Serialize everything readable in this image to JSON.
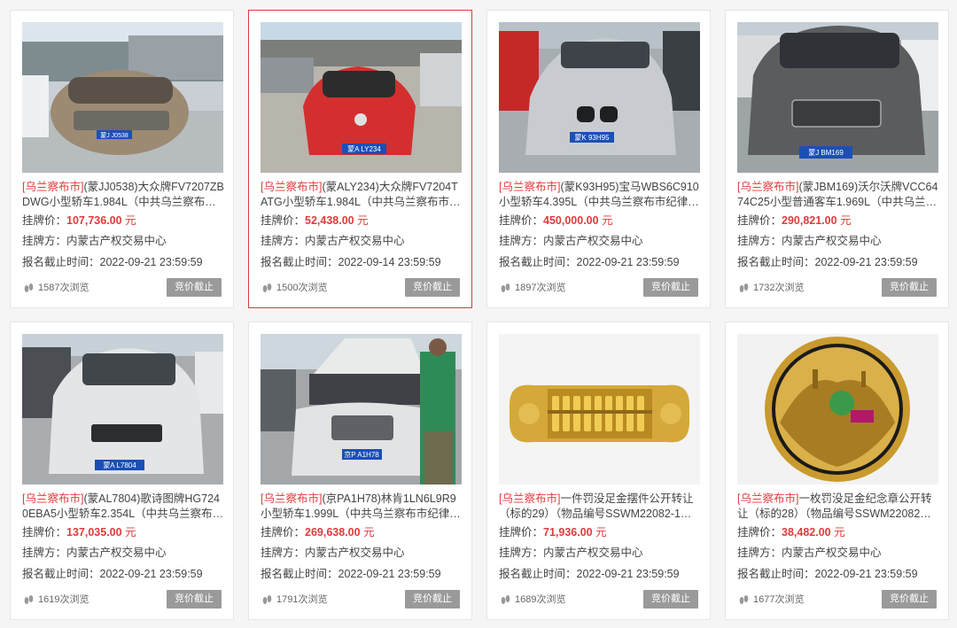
{
  "labels": {
    "price_label": "挂牌价：",
    "owner_label": "挂牌方：",
    "deadline_label": "报名截止时间：",
    "views_suffix": "次浏览",
    "currency_unit": "元"
  },
  "colors": {
    "accent": "#e03b3b",
    "button": "#9a9a9a"
  },
  "cards": [
    {
      "region": "[乌兰察布市]",
      "title": "(蒙JJ0538)大众牌FV7207ZBDWG小型轿车1.984L（中共乌兰察布…",
      "price": "107,736.00",
      "owner": "内蒙古产权交易中心",
      "deadline": "2022-09-21 23:59:59",
      "views": "1587",
      "status": "竞价截止",
      "plate": "蒙J J0538",
      "image": "silver-sedan-photo"
    },
    {
      "region": "[乌兰察布市]",
      "title": "(蒙ALY234)大众牌FV7204TATG小型轿车1.984L（中共乌兰察布市…",
      "price": "52,438.00",
      "owner": "内蒙古产权交易中心",
      "deadline": "2022-09-14 23:59:59",
      "views": "1500",
      "status": "竞价截止",
      "plate": "蒙A LY234",
      "image": "red-hatchback-photo"
    },
    {
      "region": "[乌兰察布市]",
      "title": "(蒙K93H95)宝马WBS6C910小型轿车4.395L（中共乌兰察布市纪律…",
      "price": "450,000.00",
      "owner": "内蒙古产权交易中心",
      "deadline": "2022-09-21 23:59:59",
      "views": "1897",
      "status": "竞价截止",
      "plate": "蒙K 93H95",
      "image": "silver-coupe-photo"
    },
    {
      "region": "[乌兰察布市]",
      "title": "(蒙JBM169)沃尔沃牌VCC6474C25小型普通客车1.969L（中共乌兰…",
      "price": "290,821.00",
      "owner": "内蒙古产权交易中心",
      "deadline": "2022-09-21 23:59:59",
      "views": "1732",
      "status": "竞价截止",
      "plate": "蒙J BM169",
      "image": "grey-suv-photo"
    },
    {
      "region": "[乌兰察布市]",
      "title": "(蒙AL7804)歌诗图牌HG7240EBA5小型轿车2.354L（中共乌兰察布…",
      "price": "137,035.00",
      "owner": "内蒙古产权交易中心",
      "deadline": "2022-09-21 23:59:59",
      "views": "1619",
      "status": "竞价截止",
      "plate": "蒙A L7804",
      "image": "white-crossover-photo"
    },
    {
      "region": "[乌兰察布市]",
      "title": "(京PA1H78)林肯1LN6L9R9小型轿车1.999L（中共乌兰察布市纪律…",
      "price": "269,638.00",
      "owner": "内蒙古产权交易中心",
      "deadline": "2022-09-21 23:59:59",
      "views": "1791",
      "status": "竞价截止",
      "plate": "京P A1H78",
      "image": "white-sedan-hood-open-photo"
    },
    {
      "region": "[乌兰察布市]",
      "title": "一件罚没足金摆件公开转让（标的29）（物品编号SSWM22082-1…",
      "price": "71,936.00",
      "owner": "内蒙古产权交易中心",
      "deadline": "2022-09-21 23:59:59",
      "views": "1689",
      "status": "竞价截止",
      "plate": "",
      "image": "gold-abacus-photo"
    },
    {
      "region": "[乌兰察布市]",
      "title": "一枚罚没足金纪念章公开转让（标的28）（物品编号SSWM22082…",
      "price": "38,482.00",
      "owner": "内蒙古产权交易中心",
      "deadline": "2022-09-21 23:59:59",
      "views": "1677",
      "status": "竞价截止",
      "plate": "",
      "image": "gold-medal-photo"
    }
  ]
}
